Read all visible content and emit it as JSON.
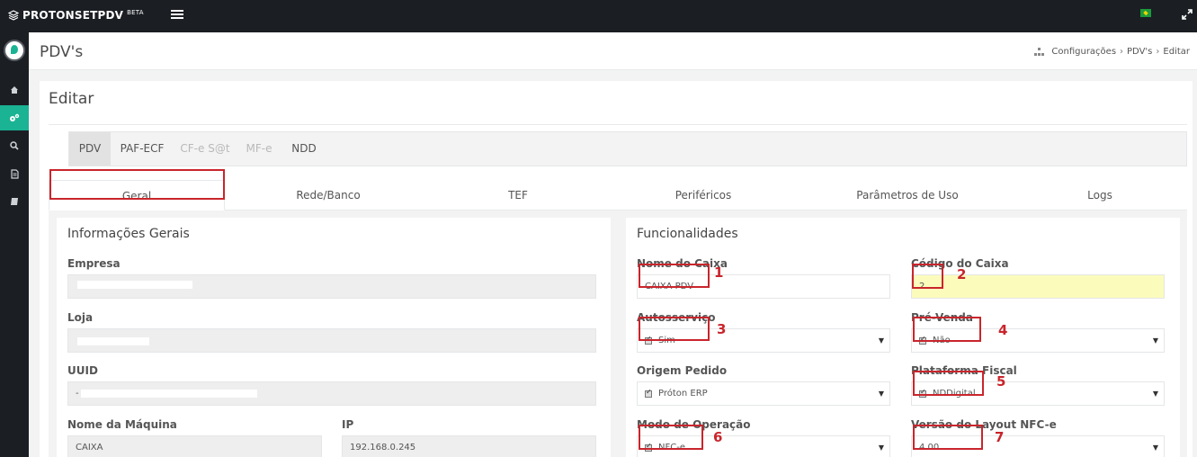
{
  "app": {
    "brand": "PROTONSETPDV",
    "badge": "BETA"
  },
  "page": {
    "title": "PDV's",
    "breadcrumb": [
      "Configurações",
      "PDV's",
      "Editar"
    ]
  },
  "card": {
    "title": "Editar"
  },
  "pilltabs": [
    {
      "label": "PDV",
      "state": "active"
    },
    {
      "label": "PAF-ECF",
      "state": "normal"
    },
    {
      "label": "CF-e S@t",
      "state": "disabled"
    },
    {
      "label": "MF-e",
      "state": "disabled"
    },
    {
      "label": "NDD",
      "state": "normal"
    }
  ],
  "tabs": [
    "Geral",
    "Rede/Banco",
    "TEF",
    "Periféricos",
    "Parâmetros de Uso",
    "Logs"
  ],
  "geral": {
    "title": "Informações Gerais",
    "empresa_label": "Empresa",
    "loja_label": "Loja",
    "uuid_label": "UUID",
    "uuid_prefix": "-",
    "maquina_label": "Nome da Máquina",
    "maquina_value": "CAIXA",
    "ip_label": "IP",
    "ip_value": "192.168.0.245"
  },
  "func": {
    "title": "Funcionalidades",
    "nome_caixa_label": "Nome do Caixa",
    "nome_caixa_value": "CAIXA PDV",
    "codigo_caixa_label": "Código do Caixa",
    "codigo_caixa_value": "2",
    "autoservico_label": "Autosserviço",
    "autoservico_value": "Sim",
    "prevenda_label": "Pré-Venda",
    "prevenda_value": "Não",
    "origem_label": "Origem Pedido",
    "origem_value": "Próton ERP",
    "plataforma_label": "Plataforma Fiscal",
    "plataforma_value": "NDDigital",
    "modo_label": "Modo de Operação",
    "modo_value": "NFC-e",
    "versao_label": "Versão do Layout NFC-e",
    "versao_value": "4.00"
  },
  "annotations": [
    "1",
    "2",
    "3",
    "4",
    "5",
    "6",
    "7"
  ],
  "colors": {
    "accent": "#1ab394",
    "annotation": "#c9252c",
    "topbar": "#1b1f24",
    "highlight": "#fbfbbc"
  }
}
